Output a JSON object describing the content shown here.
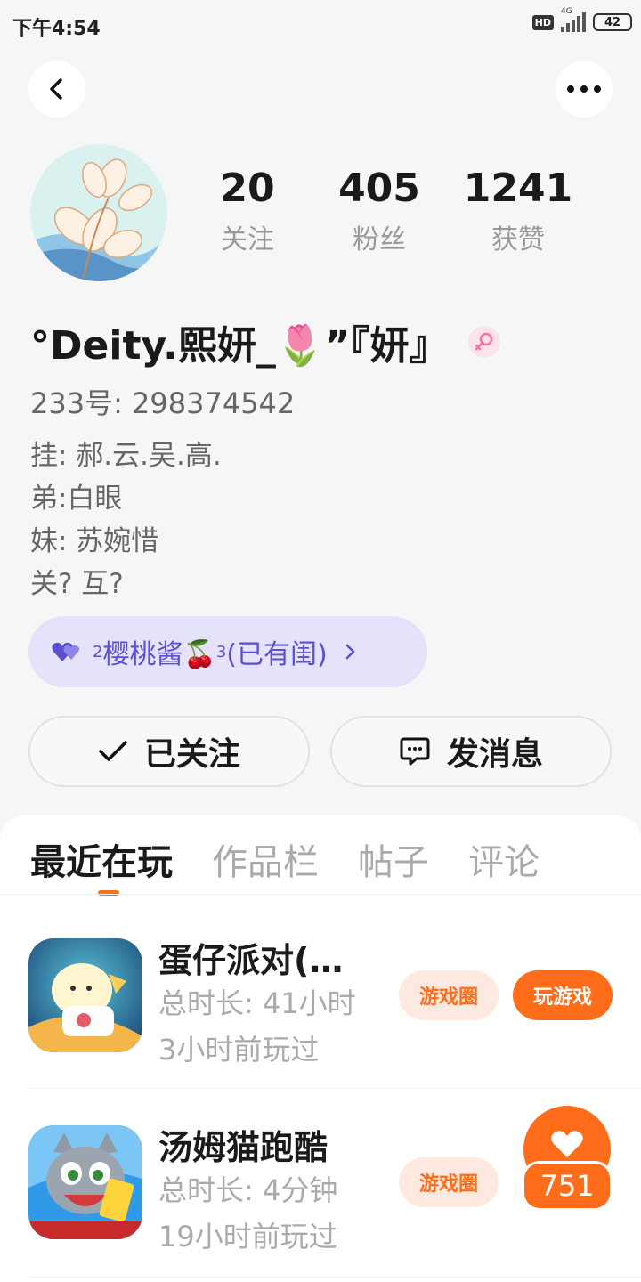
{
  "status_bar": {
    "time": "下午4:54",
    "hd": "HD",
    "network": "4G",
    "battery": "42"
  },
  "stats": [
    {
      "value": "20",
      "label": "关注"
    },
    {
      "value": "405",
      "label": "粉丝"
    },
    {
      "value": "1241",
      "label": "获赞"
    }
  ],
  "profile": {
    "name": "°Deity.熙妍_🌷”『妍』",
    "uid": "233号: 298374542",
    "bio": [
      "挂: 郝.云.吴.高.",
      "弟:白眼",
      "妹: 苏婉惜",
      "关? 互?"
    ],
    "cp_badge": {
      "prefix": "2",
      "name": "樱桃酱🍒",
      "suffix": "3",
      "status": "(已有闺)"
    }
  },
  "actions": {
    "follow": "已关注",
    "message": "发消息"
  },
  "tabs": [
    "最近在玩",
    "作品栏",
    "帖子",
    "评论"
  ],
  "games": [
    {
      "title": "蛋仔派对(…",
      "duration": "总时长: 41小时",
      "last_played": "3小时前玩过",
      "circle": "游戏圈",
      "play": "玩游戏"
    },
    {
      "title": "汤姆猫跑酷",
      "duration": "总时长: 4分钟",
      "last_played": "19小时前玩过",
      "circle": "游戏圈",
      "play": ""
    }
  ],
  "like_count": "751",
  "colors": {
    "accent": "#ff6d1a",
    "badge_text": "#5a4fcf",
    "badge_bg": "#e4e3fb"
  }
}
